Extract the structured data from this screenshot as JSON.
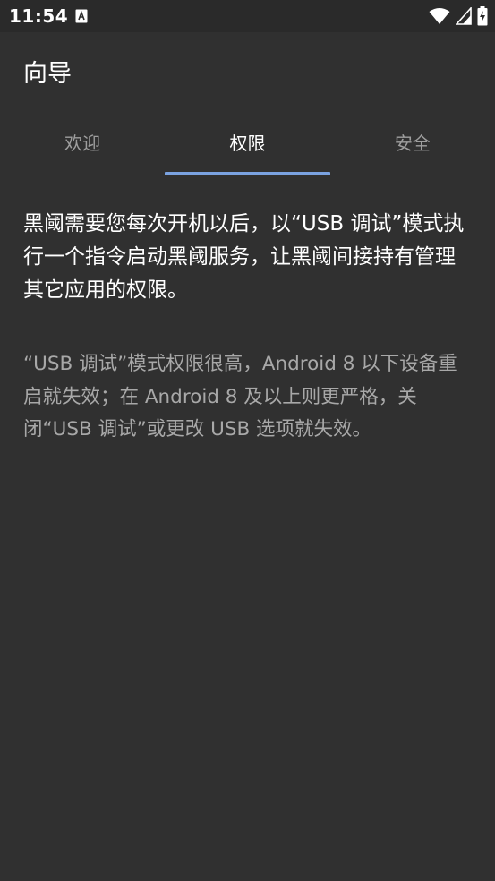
{
  "status_bar": {
    "time": "11:54",
    "notification_icon": "a-letter-icon",
    "wifi_icon": "wifi-icon",
    "signal_icon": "cell-signal-icon",
    "battery_icon": "battery-charging-icon"
  },
  "app": {
    "title": "向导"
  },
  "tabs": [
    {
      "label": "欢迎",
      "selected": false
    },
    {
      "label": "权限",
      "selected": true
    },
    {
      "label": "安全",
      "selected": false
    }
  ],
  "content": {
    "main_text": "黑阈需要您每次开机以后，以“USB 调试”模式执行一个指令启动黑阈服务，让黑阈间接持有管理其它应用的权限。",
    "note_text": "“USB 调试”模式权限很高，Android 8 以下设备重启就失效；在 Android 8 及以上则更严格，关闭“USB 调试”或更改 USB 选项就失效。"
  },
  "colors": {
    "background": "#303030",
    "status_bar": "#2a2a2a",
    "accent": "#7aa2e0",
    "text_primary": "#ffffff",
    "text_secondary": "#a8a8a8",
    "tab_inactive": "#9e9e9e"
  }
}
